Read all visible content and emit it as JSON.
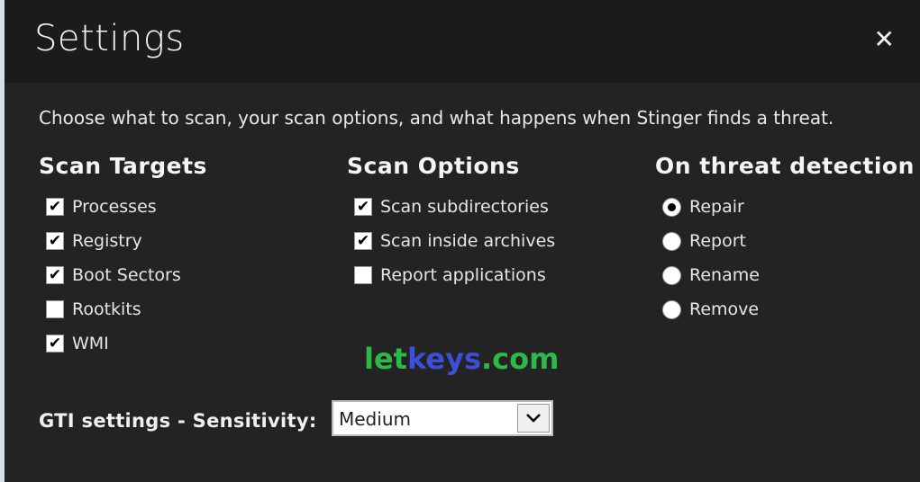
{
  "header": {
    "title": "Settings",
    "close_icon": "close-icon"
  },
  "intro": "Choose what to scan, your scan options, and what happens when Stinger finds a threat.",
  "scan_targets": {
    "heading": "Scan Targets",
    "items": [
      {
        "label": "Processes",
        "checked": true
      },
      {
        "label": "Registry",
        "checked": true
      },
      {
        "label": "Boot Sectors",
        "checked": true
      },
      {
        "label": "Rootkits",
        "checked": false
      },
      {
        "label": "WMI",
        "checked": true
      }
    ]
  },
  "scan_options": {
    "heading": "Scan Options",
    "items": [
      {
        "label": "Scan subdirectories",
        "checked": true
      },
      {
        "label": "Scan inside archives",
        "checked": true
      },
      {
        "label": "Report applications",
        "checked": false
      }
    ]
  },
  "threat": {
    "heading": "On threat detection",
    "items": [
      {
        "label": "Repair",
        "selected": true
      },
      {
        "label": "Report",
        "selected": false
      },
      {
        "label": "Rename",
        "selected": false
      },
      {
        "label": "Remove",
        "selected": false
      }
    ]
  },
  "watermark": {
    "part1": "let",
    "part2": "keys",
    "part3": ".com",
    "colors": {
      "green": "#2db84a",
      "blue": "#3b4fd8"
    }
  },
  "gti": {
    "label": "GTI settings - Sensitivity:",
    "value": "Medium"
  }
}
